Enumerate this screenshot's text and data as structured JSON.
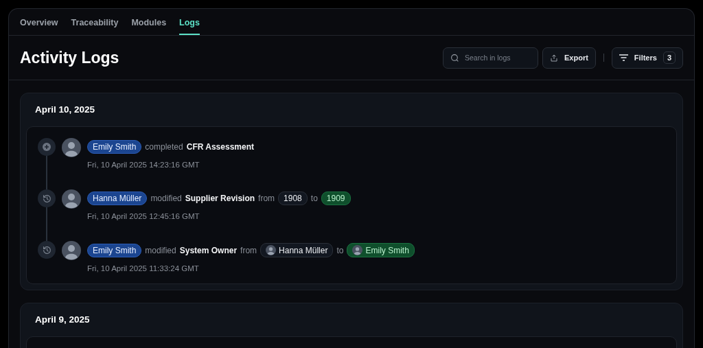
{
  "tabs": [
    {
      "label": "Overview",
      "selected": false
    },
    {
      "label": "Traceability",
      "selected": false
    },
    {
      "label": "Modules",
      "selected": false
    },
    {
      "label": "Logs",
      "selected": true
    }
  ],
  "header": {
    "title": "Activity Logs",
    "search": {
      "placeholder": "Search in logs"
    },
    "export_button": "Export",
    "filters_button": {
      "label": "Filters",
      "count": "3"
    }
  },
  "days": [
    {
      "date": "April 10, 2025",
      "entries": [
        {
          "kind": "completed",
          "user": "Emily Smith",
          "verb": "completed",
          "object": "CFR Assessment",
          "time": "Fri, 10 April 2025 14:23:16 GMT"
        },
        {
          "kind": "modified",
          "user": "Hanna Müller",
          "verb": "modified",
          "object": "Supplier Revision",
          "from_word": "from",
          "from": {
            "kind": "text",
            "text": "1908"
          },
          "to_word": "to",
          "to": {
            "kind": "text",
            "text": "1909"
          },
          "time": "Fri, 10 April 2025 12:45:16 GMT"
        },
        {
          "kind": "modified",
          "user": "Emily Smith",
          "verb": "modified",
          "object": "System Owner",
          "from_word": "from",
          "from": {
            "kind": "user",
            "text": "Hanna Müller"
          },
          "to_word": "to",
          "to": {
            "kind": "user",
            "text": "Emily Smith"
          },
          "time": "Fri, 10 April 2025 11:33:24 GMT"
        }
      ]
    },
    {
      "date": "April 9, 2025"
    }
  ]
}
